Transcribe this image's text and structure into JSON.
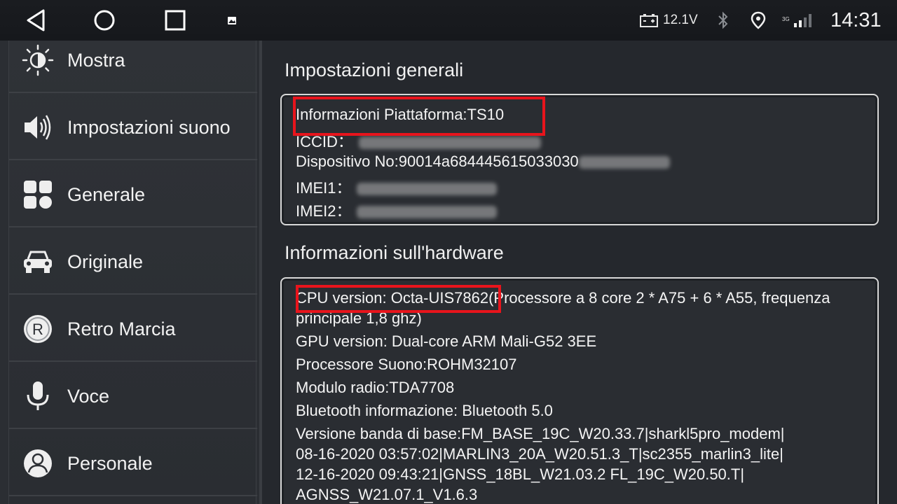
{
  "status_bar": {
    "voltage": "12.1V",
    "network": "3G",
    "time": "14:31"
  },
  "sidebar": {
    "items": [
      {
        "label": "Mostra",
        "icon": "brightness-icon"
      },
      {
        "label": "Impostazioni suono",
        "icon": "speaker-icon"
      },
      {
        "label": "Generale",
        "icon": "apps-grid-icon"
      },
      {
        "label": "Originale",
        "icon": "car-icon"
      },
      {
        "label": "Retro Marcia",
        "icon": "reverse-r-icon"
      },
      {
        "label": "Voce",
        "icon": "microphone-icon"
      },
      {
        "label": "Personale",
        "icon": "person-icon"
      }
    ]
  },
  "general": {
    "title": "Impostazioni generali",
    "platform": "Informazioni Piattaforma:TS10",
    "iccid": "ICCID：",
    "device": "Dispositivo No:90014a684445615033030",
    "imei1": "IMEI1：",
    "imei2": "IMEI2："
  },
  "hardware": {
    "title": "Informazioni sull'hardware",
    "cpu_line1": "CPU version: Octa-UIS7862(Processore a 8 core 2 * A75 + 6 * A55, frequenza",
    "cpu_line2": "principale 1,8 ghz)",
    "gpu": "GPU version: Dual-core ARM Mali-G52 3EE",
    "sound": "Processore Suono:ROHM32107",
    "radio": "Modulo radio:TDA7708",
    "bluetooth": "Bluetooth informazione: Bluetooth 5.0",
    "baseband_line1": "Versione banda di base:FM_BASE_19C_W20.33.7|sharkl5pro_modem|",
    "baseband_line2": "08-16-2020 03:57:02|MARLIN3_20A_W20.51.3_T|sc2355_marlin3_lite|",
    "baseband_line3": "12-16-2020 09:43:21|GNSS_18BL_W21.03.2 FL_19C_W20.50.T|",
    "baseband_line4": "AGNSS_W21.07.1_V1.6.3"
  },
  "colors": {
    "highlight": "#e8141c",
    "background": "#25282d"
  }
}
